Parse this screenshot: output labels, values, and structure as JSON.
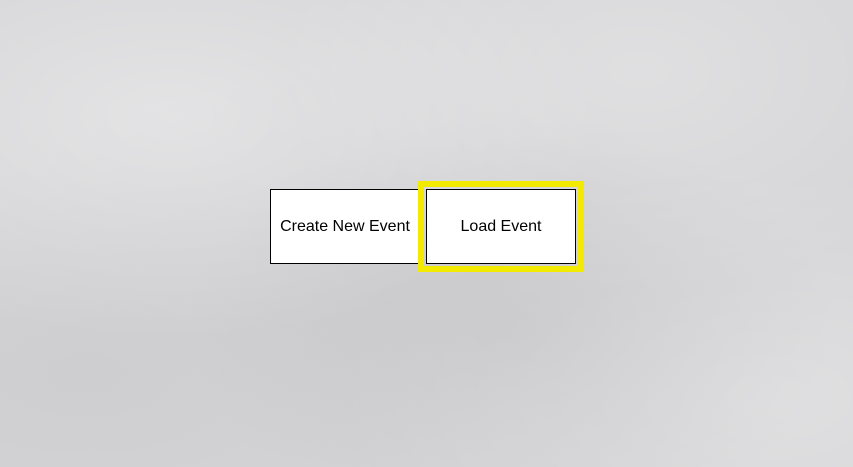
{
  "menu": {
    "create_label": "Create New Event",
    "load_label": "Load Event"
  },
  "colors": {
    "background": "#d5d5d7",
    "button_bg": "#ffffff",
    "button_border": "#000000",
    "focus_highlight": "#f2ea00"
  },
  "state": {
    "focused_button": "Load Event"
  }
}
